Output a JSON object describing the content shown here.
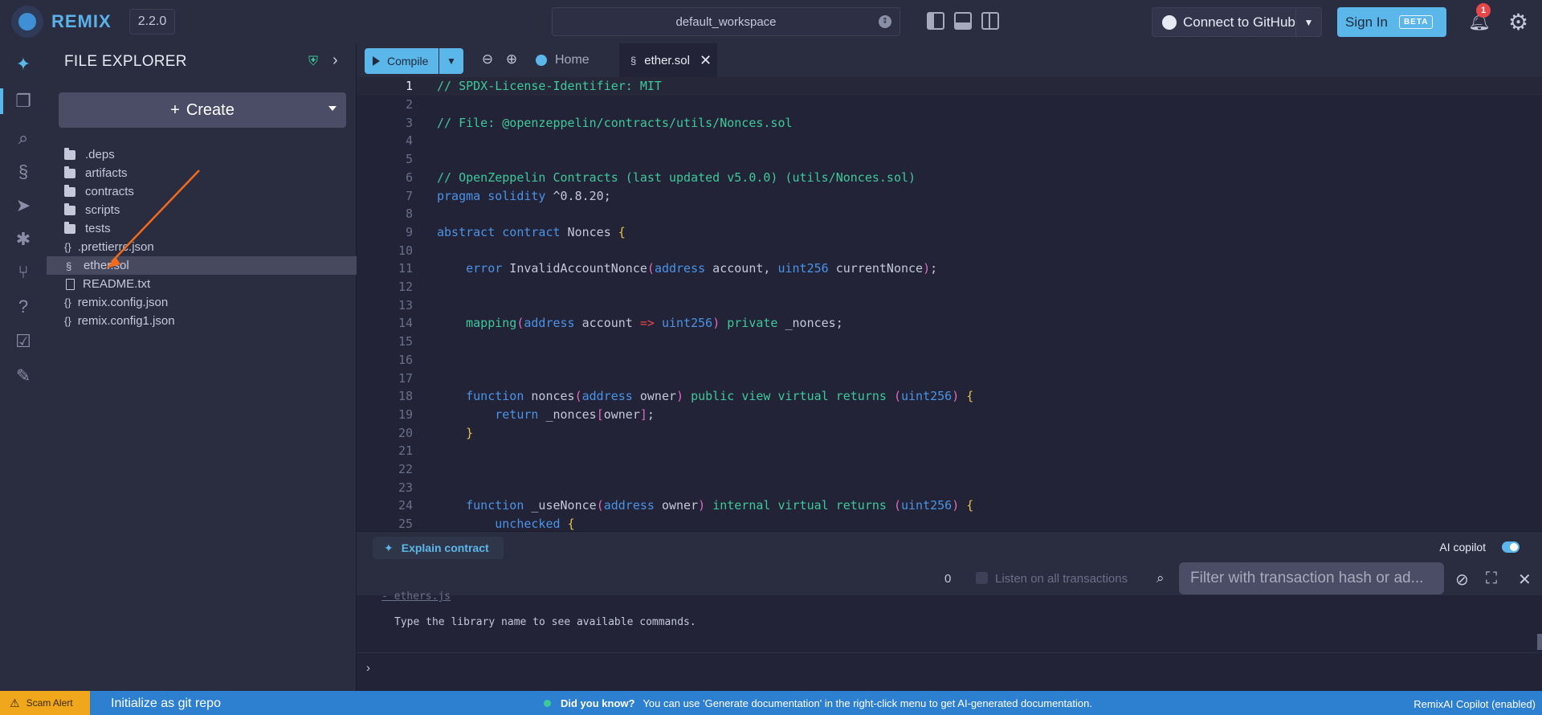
{
  "topbar": {
    "brand": "REMIX",
    "version": "2.2.0",
    "workspace": "default_workspace",
    "github_label": "Connect to GitHub",
    "signin_label": "Sign In",
    "beta_label": "BETA",
    "notification_count": "1"
  },
  "explorer": {
    "title": "FILE EXPLORER",
    "create_label": "Create",
    "items": [
      {
        "name": ".deps",
        "type": "folder"
      },
      {
        "name": "artifacts",
        "type": "folder"
      },
      {
        "name": "contracts",
        "type": "folder"
      },
      {
        "name": "scripts",
        "type": "folder"
      },
      {
        "name": "tests",
        "type": "folder"
      },
      {
        "name": ".prettierrc.json",
        "type": "json"
      },
      {
        "name": "ether.sol",
        "type": "sol"
      },
      {
        "name": "README.txt",
        "type": "file"
      },
      {
        "name": "remix.config.json",
        "type": "json"
      },
      {
        "name": "remix.config1.json",
        "type": "json"
      }
    ]
  },
  "editor": {
    "compile_label": "Compile",
    "home_tab": "Home",
    "active_tab": "ether.sol",
    "lines": [
      {
        "n": "1",
        "t": "// SPDX-License-Identifier: MIT"
      },
      {
        "n": "2",
        "t": ""
      },
      {
        "n": "3",
        "t": "// File: @openzeppelin/contracts/utils/Nonces.sol"
      },
      {
        "n": "4",
        "t": ""
      },
      {
        "n": "5",
        "t": ""
      },
      {
        "n": "6",
        "t": "// OpenZeppelin Contracts (last updated v5.0.0) (utils/Nonces.sol)"
      },
      {
        "n": "7",
        "t": "pragma solidity ^0.8.20;"
      },
      {
        "n": "8",
        "t": ""
      },
      {
        "n": "9",
        "t": "abstract contract Nonces {"
      },
      {
        "n": "10",
        "t": ""
      },
      {
        "n": "11",
        "t": "    error InvalidAccountNonce(address account, uint256 currentNonce);"
      },
      {
        "n": "12",
        "t": ""
      },
      {
        "n": "13",
        "t": ""
      },
      {
        "n": "14",
        "t": "    mapping(address account => uint256) private _nonces;"
      },
      {
        "n": "15",
        "t": ""
      },
      {
        "n": "16",
        "t": ""
      },
      {
        "n": "17",
        "t": ""
      },
      {
        "n": "18",
        "t": "    function nonces(address owner) public view virtual returns (uint256) {"
      },
      {
        "n": "19",
        "t": "        return _nonces[owner];"
      },
      {
        "n": "20",
        "t": "    }"
      },
      {
        "n": "21",
        "t": ""
      },
      {
        "n": "22",
        "t": ""
      },
      {
        "n": "23",
        "t": ""
      },
      {
        "n": "24",
        "t": "    function _useNonce(address owner) internal virtual returns (uint256) {"
      },
      {
        "n": "25",
        "t": "        unchecked {"
      }
    ]
  },
  "assistant": {
    "explain_label": "Explain contract",
    "copilot_label": "AI copilot"
  },
  "terminal": {
    "count": "0",
    "listen_label": "Listen on all transactions",
    "filter_placeholder": "Filter with transaction hash or ad...",
    "line1": "- ethers.js",
    "line2": "Type the library name to see available commands."
  },
  "statusbar": {
    "scam_label": "Scam Alert",
    "git_label": "Initialize as git repo",
    "tip_title": "Did you know?",
    "tip_text": "You can use 'Generate documentation' in the right-click menu to get AI-generated documentation.",
    "right_label": "RemixAI Copilot (enabled)"
  }
}
